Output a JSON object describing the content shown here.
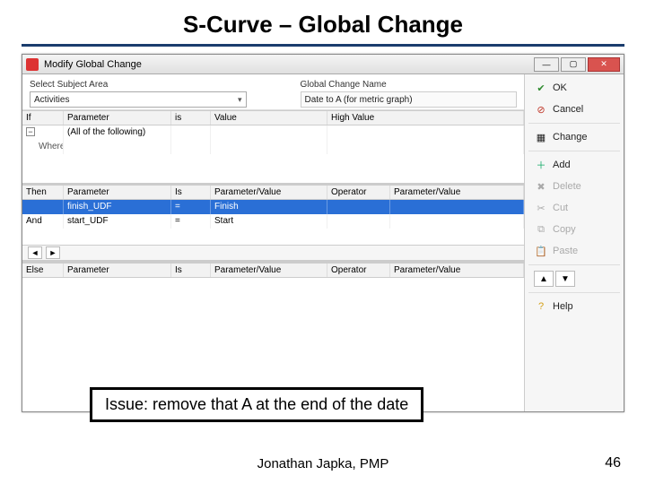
{
  "slide": {
    "title": "S-Curve – Global Change",
    "callout": "Issue: remove that A at the end of the date",
    "footer": "Jonathan Japka, PMP",
    "page": "46"
  },
  "window": {
    "title": "Modify Global Change",
    "controls": {
      "min": "—",
      "max": "▢",
      "close": "✕"
    }
  },
  "top": {
    "subject_label": "Select Subject Area",
    "subject_value": "Activities",
    "name_label": "Global Change Name",
    "name_value": "Date to A (for metric graph)"
  },
  "if_grid": {
    "labels": {
      "if": "If",
      "where": "Where"
    },
    "headers": {
      "param": "Parameter",
      "is": "is",
      "value": "Value",
      "high": "High Value"
    },
    "summary_param": "(All of the following)"
  },
  "then_grid": {
    "labels": {
      "then": "Then",
      "and": "And"
    },
    "headers": {
      "param": "Parameter",
      "is": "Is",
      "pv": "Parameter/Value",
      "op": "Operator",
      "pv2": "Parameter/Value"
    },
    "rows": [
      {
        "param": "finish_UDF",
        "is": "=",
        "pv": "Finish",
        "op": "",
        "pv2": ""
      },
      {
        "param": "start_UDF",
        "is": "=",
        "pv": "Start",
        "op": "",
        "pv2": ""
      }
    ]
  },
  "else_grid": {
    "label": "Else",
    "headers": {
      "param": "Parameter",
      "is": "Is",
      "pv": "Parameter/Value",
      "op": "Operator",
      "pv2": "Parameter/Value"
    }
  },
  "side": {
    "ok": "OK",
    "cancel": "Cancel",
    "change": "Change",
    "add": "Add",
    "delete": "Delete",
    "cut": "Cut",
    "copy": "Copy",
    "paste": "Paste",
    "help": "Help"
  },
  "icons": {
    "ok": "✔",
    "cancel": "⊘",
    "change": "▦",
    "add": "＋",
    "delete": "✖",
    "cut": "✂",
    "copy": "⧉",
    "paste": "📋",
    "help": "?"
  },
  "colors": {
    "accent": "#2a6fd6",
    "ok": "#2e8b2e",
    "cancel": "#c0392b"
  }
}
